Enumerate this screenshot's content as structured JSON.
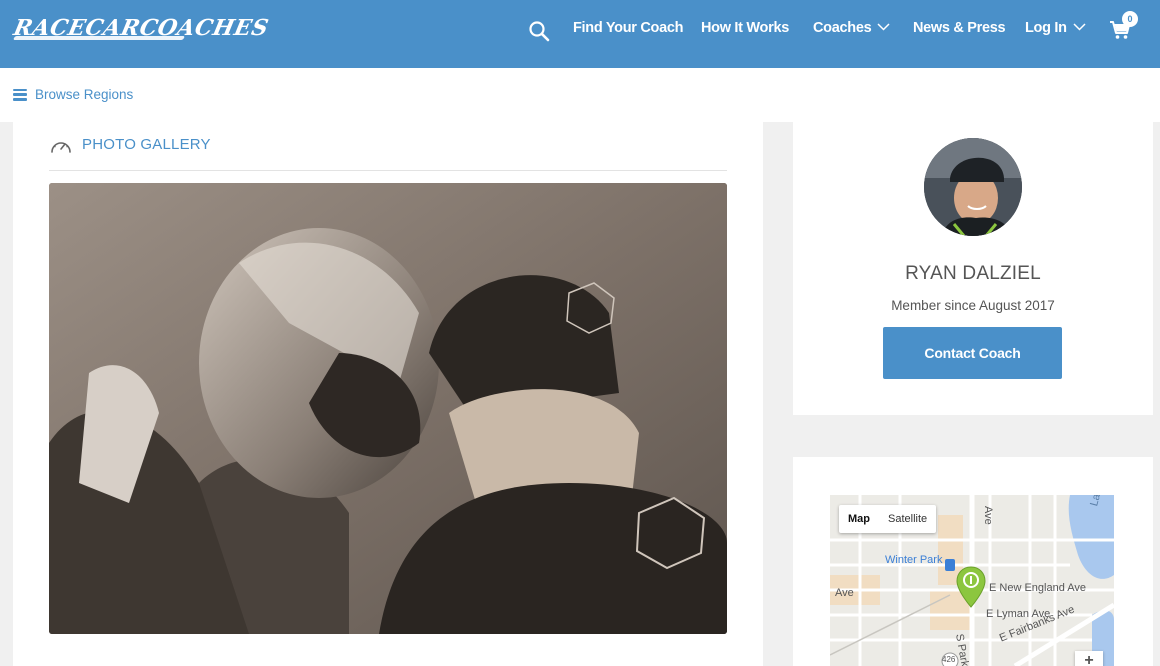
{
  "brand": {
    "logo_text": "RaceCarCoaches"
  },
  "nav": {
    "search_icon": "search-icon",
    "items": [
      {
        "label": "Find Your Coach",
        "dropdown": false
      },
      {
        "label": "How It Works",
        "dropdown": false
      },
      {
        "label": "Coaches",
        "dropdown": true
      },
      {
        "label": "News & Press",
        "dropdown": false
      },
      {
        "label": "Log In",
        "dropdown": true
      }
    ],
    "cart_count": "0"
  },
  "subbar": {
    "browse_label": "Browse Regions"
  },
  "gallery": {
    "title": "PHOTO GALLERY"
  },
  "coach": {
    "name": "RYAN DALZIEL",
    "member_since": "Member since August 2017",
    "contact_label": "Contact Coach"
  },
  "map": {
    "type_map": "Map",
    "type_satellite": "Satellite",
    "labels": {
      "winter_park": "Winter Park",
      "new_england": "E New England Ave",
      "lyman": "E Lyman Ave",
      "fairbanks": "E Fairbanks Ave",
      "park_ave": "S Park Ave",
      "ave_left": "Ave",
      "ave_top": "Ave",
      "lake": "Lake",
      "route": "426"
    },
    "zoom_in": "+"
  },
  "colors": {
    "brand_blue": "#4a90c9",
    "map_pin": "#8cc63f"
  }
}
